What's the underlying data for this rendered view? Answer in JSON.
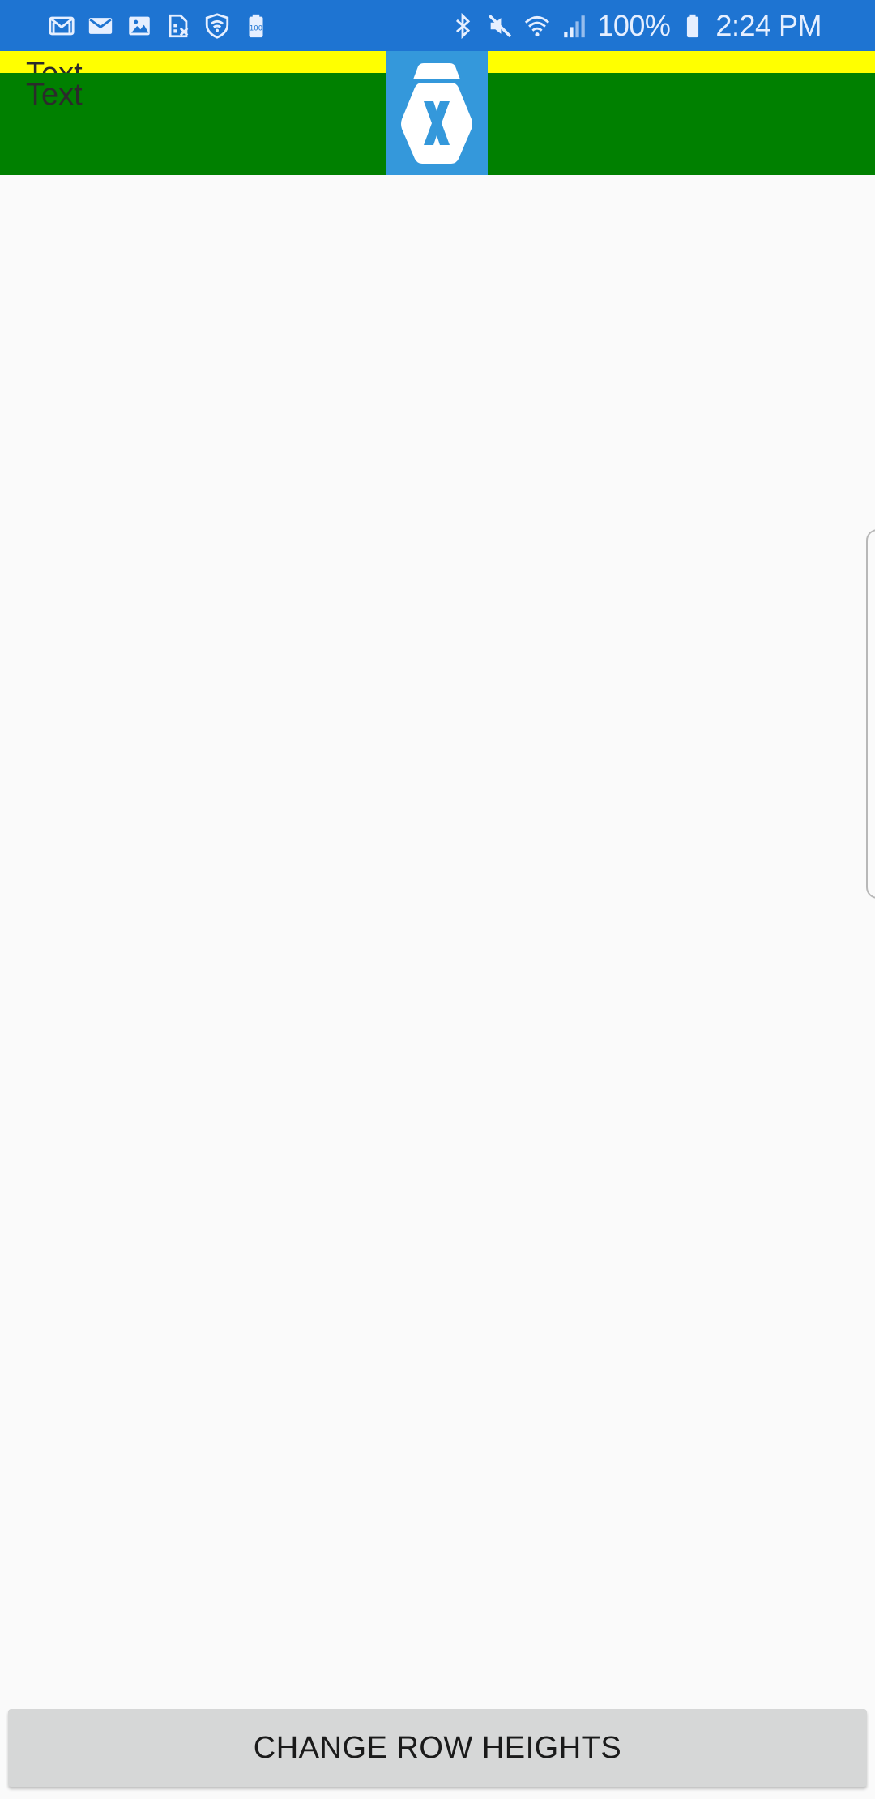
{
  "status_bar": {
    "left_icons": [
      "gmail-icon",
      "email-icon",
      "gallery-icon",
      "sim-icon",
      "shield-wifi-icon",
      "battery-saver-icon"
    ],
    "right_icons": [
      "bluetooth-icon",
      "mute-icon",
      "wifi-icon",
      "signal-icon"
    ],
    "battery_text": "100%",
    "time": "2:24 PM",
    "battery_badge": "100"
  },
  "grid": {
    "row1_label": "Text",
    "row2_label": "Text",
    "row1_color": "#ffff00",
    "row2_color": "#008000",
    "logo_color": "#3498db",
    "logo_icon": "xamarin-logo-icon"
  },
  "button": {
    "label": "CHANGE ROW HEIGHTS"
  },
  "colors": {
    "status_bar": "#1e74d2",
    "background": "#fafafa",
    "button": "#d6d7d7"
  }
}
